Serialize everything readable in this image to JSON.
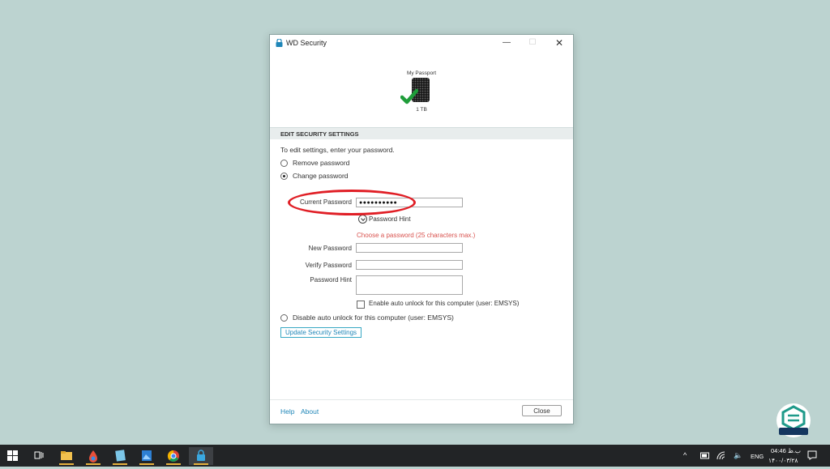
{
  "window": {
    "title": "WD Security",
    "minimize_glyph": "—",
    "maximize_glyph": "☐",
    "close_glyph": "✕"
  },
  "device": {
    "name": "My Passport",
    "capacity": "1 TB",
    "status_icon": "check-icon"
  },
  "section": {
    "title": "EDIT SECURITY SETTINGS",
    "instructions": "To edit settings, enter your password."
  },
  "options": {
    "remove_password": "Remove password",
    "change_password": "Change password",
    "selected": "change_password",
    "disable_auto_unlock": "Disable auto unlock for this computer (user: EMSYS)"
  },
  "form": {
    "current_password_label": "Current Password",
    "current_password_value": "●●●●●●●●●●",
    "password_hint_toggle": "Password Hint",
    "error_message": "Choose a password (25 characters max.)",
    "new_password_label": "New Password",
    "verify_password_label": "Verify Password",
    "password_hint_label": "Password Hint",
    "auto_unlock_label": "Enable auto unlock for this computer (user: EMSYS)",
    "auto_unlock_checked": false
  },
  "buttons": {
    "update": "Update Security Settings",
    "close": "Close"
  },
  "footer": {
    "help": "Help",
    "about": "About"
  },
  "colors": {
    "accent": "#1f86b8",
    "error": "#d9534f",
    "annotation": "#e01e25",
    "check": "#1f9d3a"
  },
  "taskbar": {
    "apps": [
      "file-explorer-icon",
      "color-app-icon",
      "notepad-icon",
      "photos-icon",
      "chrome-icon",
      "wd-security-icon"
    ],
    "language": "ENG",
    "time": "04:46 ب.ظ",
    "date": "۱۴۰۰/۰۳/۲۸"
  }
}
